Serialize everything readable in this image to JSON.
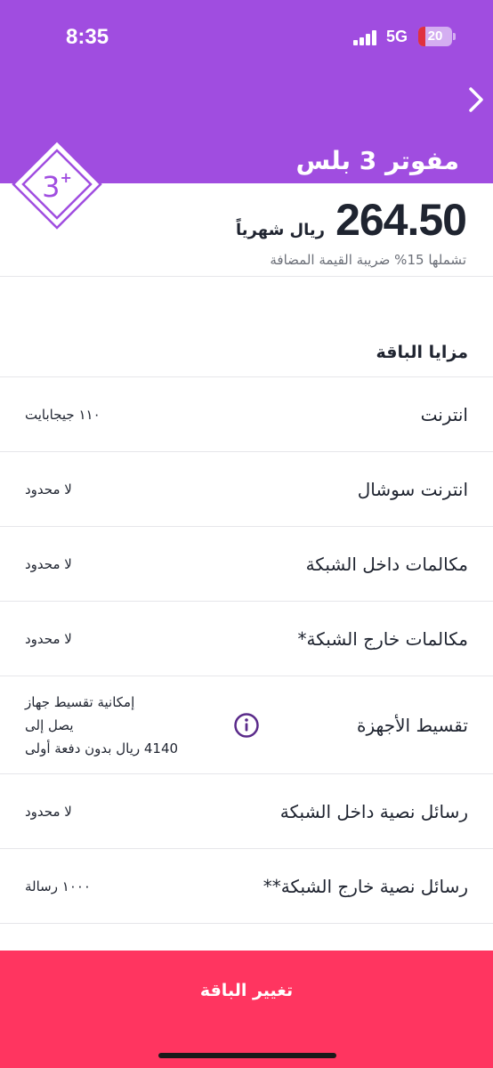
{
  "status_bar": {
    "time": "8:35",
    "network": "5G",
    "battery": "20",
    "battery_level_percent": 20,
    "colors": {
      "background": "#a04de0",
      "battery_fill": "#e0313f"
    }
  },
  "header": {
    "plan_name": "مفوتر 3 بلس",
    "badge": {
      "base": "3",
      "sup": "+"
    },
    "nav_icon": "chevron-right-icon"
  },
  "price": {
    "value": "264.50",
    "unit": "ريال شهرياً",
    "vat_note": "تشملها 15% ضريبة القيمة المضافة"
  },
  "features": {
    "title": "مزايا الباقة",
    "rows": [
      {
        "label": "انترنت",
        "value": "١١٠ جيجابايت"
      },
      {
        "label": "انترنت سوشال",
        "value": "لا محدود"
      },
      {
        "label": "مكالمات داخل الشبكة",
        "value": "لا محدود"
      },
      {
        "label": "مكالمات خارج الشبكة*",
        "value": "لا محدود"
      },
      {
        "label": "تقسيط الأجهزة",
        "value_lines": [
          "إمكانية تقسيط جهاز",
          "يصل إلى",
          "4140 ريال بدون دفعة أولى"
        ],
        "icon": "info-icon"
      },
      {
        "label": "رسائل نصية داخل الشبكة",
        "value": "لا محدود"
      },
      {
        "label": "رسائل نصية خارج الشبكة**",
        "value": "١٠٠٠ رسالة"
      }
    ]
  },
  "cta": {
    "label": "تغيير الباقة",
    "color": "#ff3560"
  },
  "theme": {
    "accent": "#a04de0",
    "text": "#1f2430",
    "muted": "#6b6f78"
  }
}
